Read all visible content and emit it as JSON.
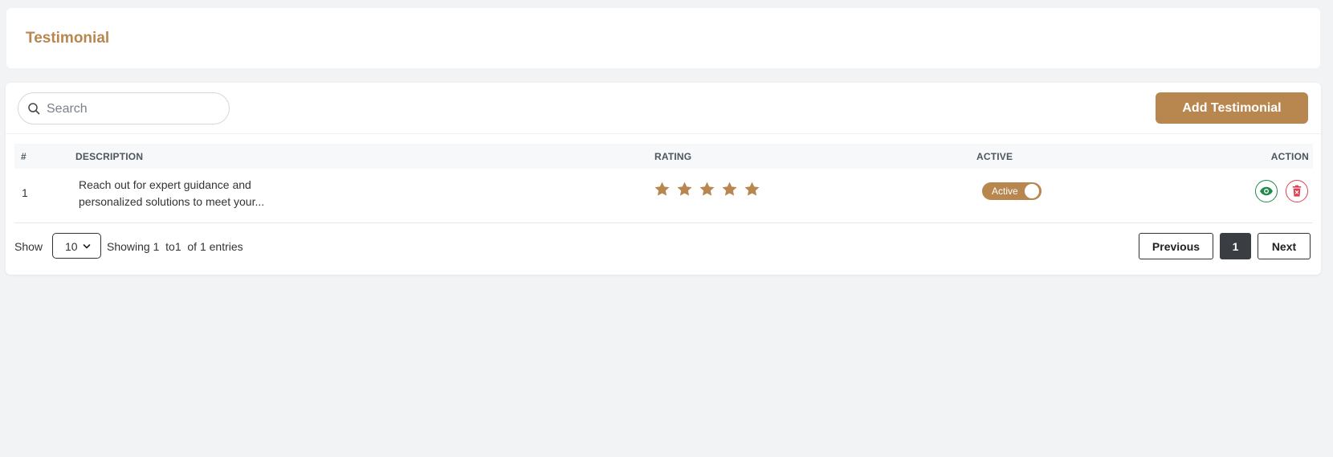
{
  "header": {
    "title": "Testimonial"
  },
  "toolbar": {
    "search_placeholder": "Search",
    "add_label": "Add Testimonial"
  },
  "table": {
    "columns": [
      "#",
      "DESCRIPTION",
      "RATING",
      "ACTIVE",
      "ACTION"
    ],
    "rows": [
      {
        "num": "1",
        "description_line1": "Reach out for expert guidance and",
        "description_line2": "personalized solutions to meet your...",
        "rating": 5,
        "rating_max": 5,
        "active_label": "Active",
        "active": true
      }
    ]
  },
  "footer": {
    "show_label": "Show",
    "page_size": "10",
    "info": "Showing 1  to1  of 1 entries",
    "prev_label": "Previous",
    "current_page": "1",
    "next_label": "Next"
  },
  "colors": {
    "accent": "#b8874f",
    "view": "#1f8a4c",
    "delete": "#e0404f",
    "active_page": "#3a3d42"
  },
  "icons": {
    "search": "search-icon",
    "star": "star-icon",
    "view": "eye-icon",
    "delete": "trash-icon",
    "dropdown": "chevron-down-icon"
  }
}
